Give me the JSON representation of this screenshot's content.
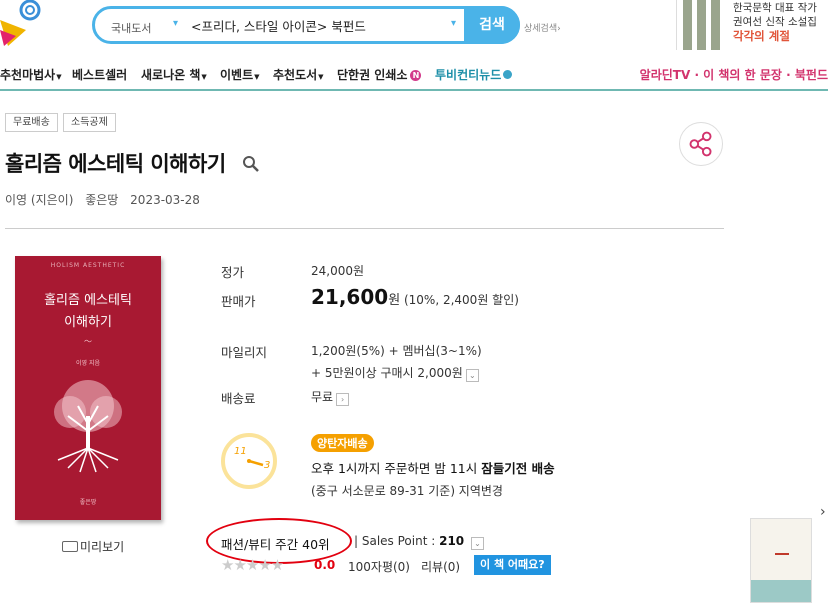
{
  "header": {
    "search_category": "국내도서",
    "search_query": "<프리다, 스타일 아이콘> 북펀드",
    "search_button": "검색",
    "advanced_search": "상세검색",
    "promo_line1": "한국문학 대표 작가",
    "promo_line2": "권여선 신작 소설집",
    "promo_line3": "각각의 계절"
  },
  "nav": {
    "items": [
      "추천마법사",
      "베스트셀러",
      "새로나온 책",
      "이벤트",
      "추천도서",
      "단한권 인쇄소",
      "투비컨티뉴드"
    ],
    "right": "알라딘TV · 이 책의 한 문장 · 북펀드"
  },
  "tags": [
    "무료배송",
    "소득공제"
  ],
  "book": {
    "title": "홀리즘 에스테틱 이해하기",
    "author": "이영 (지은이)",
    "publisher": "좋은땅",
    "date": "2023-03-28",
    "cover_top": "HOLISM AESTHETIC",
    "cover_title_1": "홀리즘 에스테틱",
    "cover_title_2": "이해하기",
    "cover_author": "이영 지음",
    "cover_publisher": "좋은땅",
    "preview": "미리보기"
  },
  "price": {
    "list_label": "정가",
    "list_value": "24,000원",
    "sale_label": "판매가",
    "sale_value": "21,600",
    "sale_unit": "원",
    "sale_note": "(10%, 2,400원 할인)",
    "mileage_label": "마일리지",
    "mileage_value": "1,200원(5%) + 멤버십(3~1%)",
    "mileage_extra": "+ 5만원이상 구매시 2,000원",
    "shipping_label": "배송료",
    "shipping_value": "무료"
  },
  "delivery": {
    "badge": "양탄자배송",
    "line1_a": "오후 1시까지 주문하면 밤 11시 ",
    "line1_b": "잠들기전 배송",
    "line2": "(중구 서소문로 89-31 기준) 지역변경",
    "clock_11": "11",
    "clock_3": "3"
  },
  "ranking": {
    "rank": "패션/뷰티 주간 40위",
    "sales_label": "Sales Point : ",
    "sales_value": "210",
    "score": "0.0",
    "reviews_100": "100자평(0)",
    "reviews": "리뷰(0)",
    "how_button": "이 책 어때요?"
  },
  "colors": {
    "accent": "#4ab3e8",
    "nav_line": "#6fb8b2",
    "cover": "#a81932",
    "highlight": "#e2000f"
  }
}
